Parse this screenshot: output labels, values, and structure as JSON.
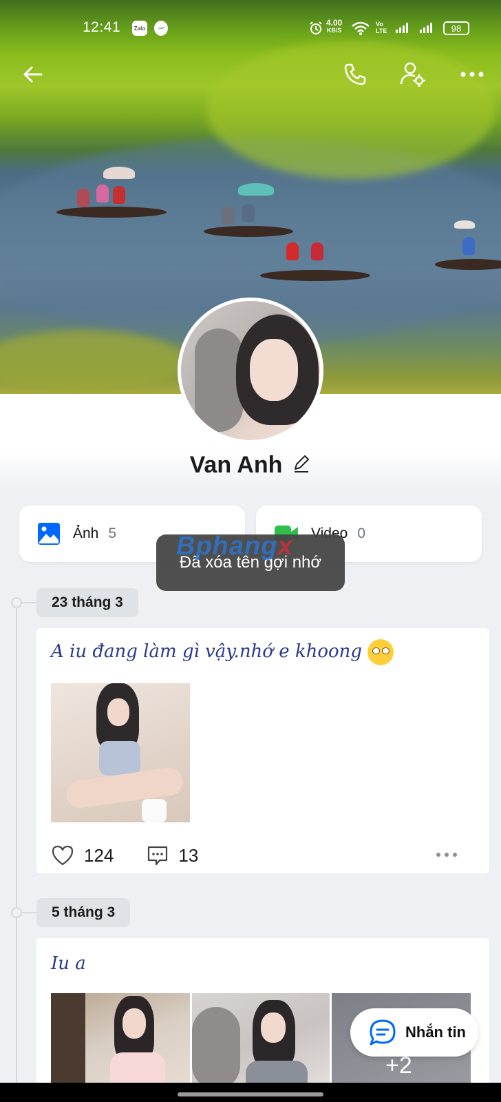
{
  "status_bar": {
    "time": "12:41",
    "notif_zalo": "Zalo",
    "speed_value": "4.00",
    "speed_unit": "KB/S",
    "volte": "Vo LTE",
    "battery": "98"
  },
  "header": {
    "back_icon": "arrow-left-icon",
    "call_icon": "phone-icon",
    "settings_icon": "user-settings-icon",
    "more_icon": "more-dots-icon"
  },
  "profile": {
    "name": "Van Anh",
    "edit_icon": "pencil-icon"
  },
  "media": {
    "photos_label": "Ảnh",
    "photos_count": "5",
    "videos_label": "Video",
    "videos_count": "0"
  },
  "toast": {
    "message": "Đã xóa tên gợi nhớ"
  },
  "watermark": {
    "part1": "Bphang",
    "part2": "x"
  },
  "posts": [
    {
      "date": "23 tháng 3",
      "text": "A iu đang làm gì vậy.nhớ e khoong",
      "likes": "124",
      "comments": "13"
    },
    {
      "date": "5 tháng 3",
      "text": "Iu a",
      "extra_photos": "+2"
    }
  ],
  "message_button": {
    "label": "Nhắn tin"
  },
  "colors": {
    "accent_blue": "#0068ff",
    "video_green": "#2fbf4a",
    "post_text": "#2b3a8c"
  }
}
